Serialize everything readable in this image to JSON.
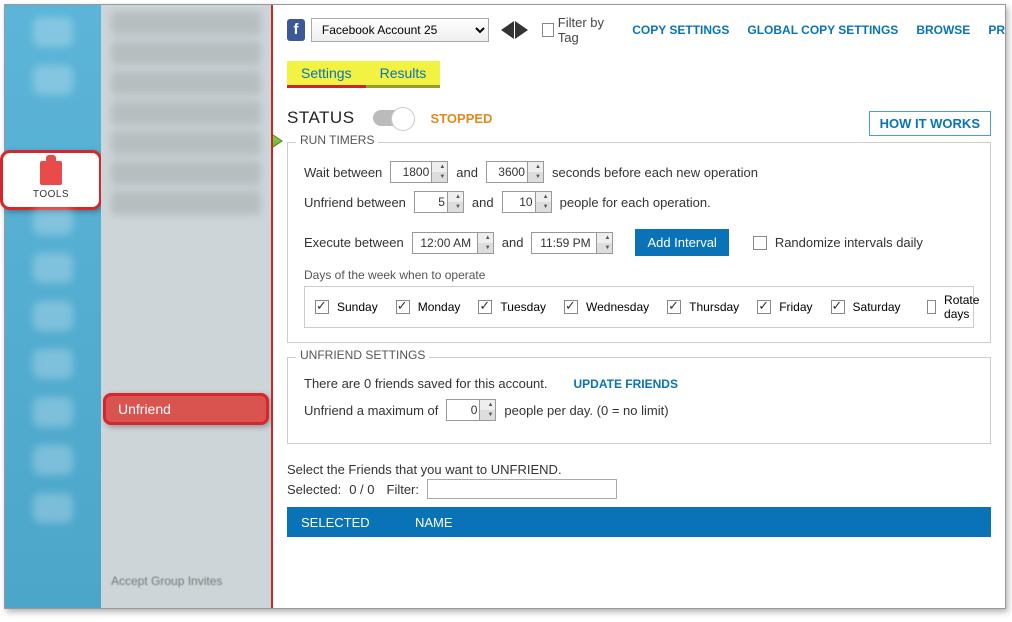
{
  "sidebar": {
    "tools_label": "TOOLS",
    "unfriend_label": "Unfriend",
    "accept_group": "Accept Group Invites"
  },
  "header": {
    "account": "Facebook Account 25",
    "filter_tag": "Filter by Tag",
    "copy_settings": "COPY SETTINGS",
    "global_copy": "GLOBAL COPY SETTINGS",
    "browse": "BROWSE",
    "pr": "PR"
  },
  "tabs": {
    "settings": "Settings",
    "results": "Results"
  },
  "status": {
    "label": "STATUS",
    "value": "STOPPED",
    "how": "HOW IT WORKS"
  },
  "run_timers": {
    "legend": "RUN TIMERS",
    "wait_txt": "Wait between",
    "wait_min": "1800",
    "wait_max": "3600",
    "wait_after": "seconds before each new operation",
    "and": "and",
    "unfriend_txt": "Unfriend between",
    "unfriend_min": "5",
    "unfriend_max": "10",
    "unfriend_after": "people for each operation.",
    "exec_txt": "Execute between",
    "exec_from": "12:00 AM",
    "exec_to": "11:59 PM",
    "add_interval": "Add Interval",
    "randomize": "Randomize intervals daily",
    "days_label": "Days of the week when to operate",
    "days": [
      "Sunday",
      "Monday",
      "Tuesday",
      "Wednesday",
      "Thursday",
      "Friday",
      "Saturday"
    ],
    "rotate": "Rotate days"
  },
  "unfriend_settings": {
    "legend": "UNFRIEND SETTINGS",
    "saved_txt": "There are 0 friends saved for this account.",
    "update": "UPDATE FRIENDS",
    "max_txt": "Unfriend a maximum of",
    "max_val": "0",
    "max_after": "people per day. (0 = no limit)"
  },
  "friends_table": {
    "select_txt": "Select the Friends that you want to UNFRIEND.",
    "selected_lbl": "Selected:",
    "selected_val": "0 / 0",
    "filter_lbl": "Filter:",
    "col_selected": "SELECTED",
    "col_name": "NAME"
  }
}
